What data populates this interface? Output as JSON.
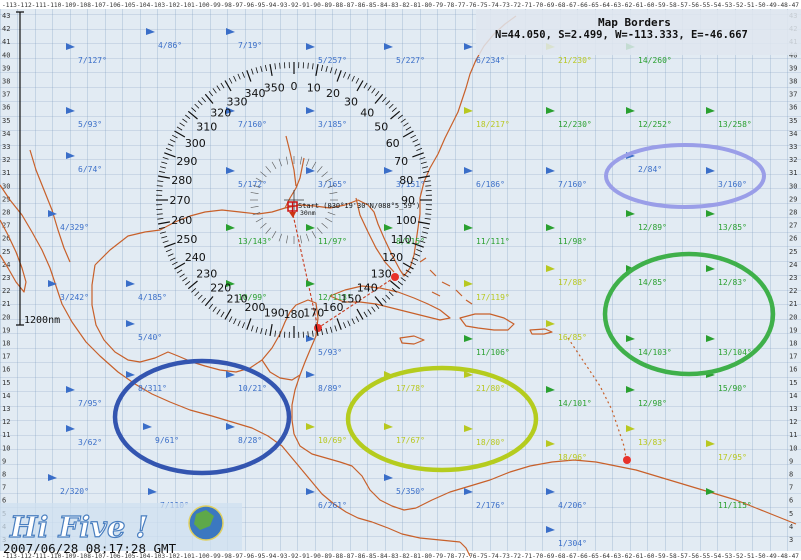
{
  "map_borders": {
    "title": "Map Borders",
    "values": "N=44.050, S=2.499, W=-113.333, E=-46.667"
  },
  "start_marker": {
    "label": "Start (030°19'30\"N/088°5_59\")",
    "sub_label": "30nm"
  },
  "scale_label": "1200nm",
  "timestamp": "2007/06/28 08:17:28 GMT",
  "logo_text": "Hi Five !",
  "compass_numbers": [
    "0",
    "10",
    "20",
    "30",
    "40",
    "50",
    "60",
    "70",
    "80",
    "90",
    "100",
    "110",
    "120",
    "130",
    "140",
    "150",
    "160",
    "170",
    "180",
    "190",
    "200",
    "210",
    "220",
    "230",
    "240",
    "250",
    "260",
    "270",
    "280",
    "290",
    "300",
    "310",
    "320",
    "330",
    "340",
    "350"
  ],
  "left_axis_labels": [
    "43",
    "42",
    "41",
    "40",
    "39",
    "38",
    "37",
    "36",
    "35",
    "34",
    "33",
    "32",
    "31",
    "30",
    "29",
    "28",
    "27",
    "26",
    "25",
    "24",
    "23",
    "22",
    "21",
    "20",
    "19",
    "18",
    "17",
    "16",
    "15",
    "14",
    "13",
    "12",
    "11",
    "10",
    "9",
    "8",
    "7",
    "6",
    "5",
    "4",
    "3"
  ],
  "right_axis_labels": [
    "43",
    "42",
    "41",
    "40",
    "39",
    "38",
    "37",
    "36",
    "35",
    "34",
    "33",
    "32",
    "31",
    "30",
    "29",
    "28",
    "27",
    "26",
    "25",
    "24",
    "23",
    "22",
    "21",
    "20",
    "19",
    "18",
    "17",
    "16",
    "15",
    "14",
    "13",
    "12",
    "11",
    "10",
    "9",
    "8",
    "7",
    "6",
    "5",
    "4",
    "3"
  ],
  "top_axis_text": "-113-112-111-110-109-108-107-106-105-104-103-102-101-100-99-98-97-96-95-94-93-92-91-90-89-88-87-86-85-84-83-82-81-80-79-78-77-76-75-74-73-72-71-70-69-68-67-66-65-64-63-62-61-60-59-58-57-56-55-54-53-52-51-50-49-48-47",
  "bottom_axis_text": "-113-112-111-110-109-108-107-106-105-104-103-102-101-100-99-98-97-96-95-94-93-92-91-90-89-88-87-86-85-84-83-82-81-80-79-78-77-76-75-74-73-72-71-70-69-68-67-66-65-64-63-62-61-60-59-58-57-56-55-54-53-52-51-50-49-48-47",
  "colors": {
    "wind_blue": "#3a6ec8",
    "wind_yellow": "#b8c820",
    "wind_green": "#2aa030",
    "coast": "#c8602a",
    "circle_blue": "#3355b0",
    "circle_yellow": "#b5cc1e",
    "circle_green": "#3fb04a",
    "circle_lavender": "#9a9ee8"
  },
  "wind_labels": [
    {
      "text": "4/86°",
      "color": "blue"
    },
    {
      "text": "7/127°",
      "color": "blue"
    },
    {
      "text": "7/19°",
      "color": "blue"
    },
    {
      "text": "5/257°",
      "color": "blue"
    },
    {
      "text": "5/227°",
      "color": "blue"
    },
    {
      "text": "6/234°",
      "color": "blue"
    },
    {
      "text": "21/230°",
      "color": "yellow"
    },
    {
      "text": "14/260°",
      "color": "green"
    },
    {
      "text": "5/93°",
      "color": "blue"
    },
    {
      "text": "7/160°",
      "color": "blue"
    },
    {
      "text": "3/185°",
      "color": "blue"
    },
    {
      "text": "18/217°",
      "color": "yellow"
    },
    {
      "text": "12/230°",
      "color": "green"
    },
    {
      "text": "12/252°",
      "color": "green"
    },
    {
      "text": "13/258°",
      "color": "green"
    },
    {
      "text": "6/74°",
      "color": "blue"
    },
    {
      "text": "5/172°",
      "color": "blue"
    },
    {
      "text": "3/165°",
      "color": "blue"
    },
    {
      "text": "3/151°",
      "color": "blue"
    },
    {
      "text": "6/186°",
      "color": "blue"
    },
    {
      "text": "7/160°",
      "color": "blue"
    },
    {
      "text": "2/84°",
      "color": "blue"
    },
    {
      "text": "3/160°",
      "color": "blue"
    },
    {
      "text": "4/329°",
      "color": "blue"
    },
    {
      "text": "13/143°",
      "color": "green"
    },
    {
      "text": "11/97°",
      "color": "green"
    },
    {
      "text": "8/115°",
      "color": "green"
    },
    {
      "text": "11/111°",
      "color": "green"
    },
    {
      "text": "11/98°",
      "color": "green"
    },
    {
      "text": "12/89°",
      "color": "green"
    },
    {
      "text": "13/85°",
      "color": "green"
    },
    {
      "text": "3/242°",
      "color": "blue"
    },
    {
      "text": "4/185°",
      "color": "blue"
    },
    {
      "text": "10/99°",
      "color": "green"
    },
    {
      "text": "12/113°",
      "color": "green"
    },
    {
      "text": "17/119°",
      "color": "yellow"
    },
    {
      "text": "17/88°",
      "color": "yellow"
    },
    {
      "text": "14/85°",
      "color": "green"
    },
    {
      "text": "12/83°",
      "color": "green"
    },
    {
      "text": "5/40°",
      "color": "blue"
    },
    {
      "text": "5/93°",
      "color": "blue"
    },
    {
      "text": "11/106°",
      "color": "green"
    },
    {
      "text": "16/85°",
      "color": "yellow"
    },
    {
      "text": "14/103°",
      "color": "green"
    },
    {
      "text": "13/104°",
      "color": "green"
    },
    {
      "text": "8/311°",
      "color": "blue"
    },
    {
      "text": "10/21°",
      "color": "blue"
    },
    {
      "text": "8/89°",
      "color": "blue"
    },
    {
      "text": "17/78°",
      "color": "yellow"
    },
    {
      "text": "21/80°",
      "color": "yellow"
    },
    {
      "text": "7/95°",
      "color": "blue"
    },
    {
      "text": "14/101°",
      "color": "green"
    },
    {
      "text": "12/98°",
      "color": "green"
    },
    {
      "text": "15/90°",
      "color": "green"
    },
    {
      "text": "3/62°",
      "color": "blue"
    },
    {
      "text": "9/61°",
      "color": "blue"
    },
    {
      "text": "8/28°",
      "color": "blue"
    },
    {
      "text": "10/69°",
      "color": "yellow"
    },
    {
      "text": "17/67°",
      "color": "yellow"
    },
    {
      "text": "18/80°",
      "color": "yellow"
    },
    {
      "text": "18/96°",
      "color": "yellow"
    },
    {
      "text": "13/83°",
      "color": "yellow"
    },
    {
      "text": "17/95°",
      "color": "yellow"
    },
    {
      "text": "2/320°",
      "color": "blue"
    },
    {
      "text": "5/350°",
      "color": "blue"
    },
    {
      "text": "6/261°",
      "color": "blue"
    },
    {
      "text": "2/176°",
      "color": "blue"
    },
    {
      "text": "4/206°",
      "color": "blue"
    },
    {
      "text": "11/115°",
      "color": "green"
    },
    {
      "text": "7/110°",
      "color": "blue"
    },
    {
      "text": "1/304°",
      "color": "blue"
    }
  ]
}
